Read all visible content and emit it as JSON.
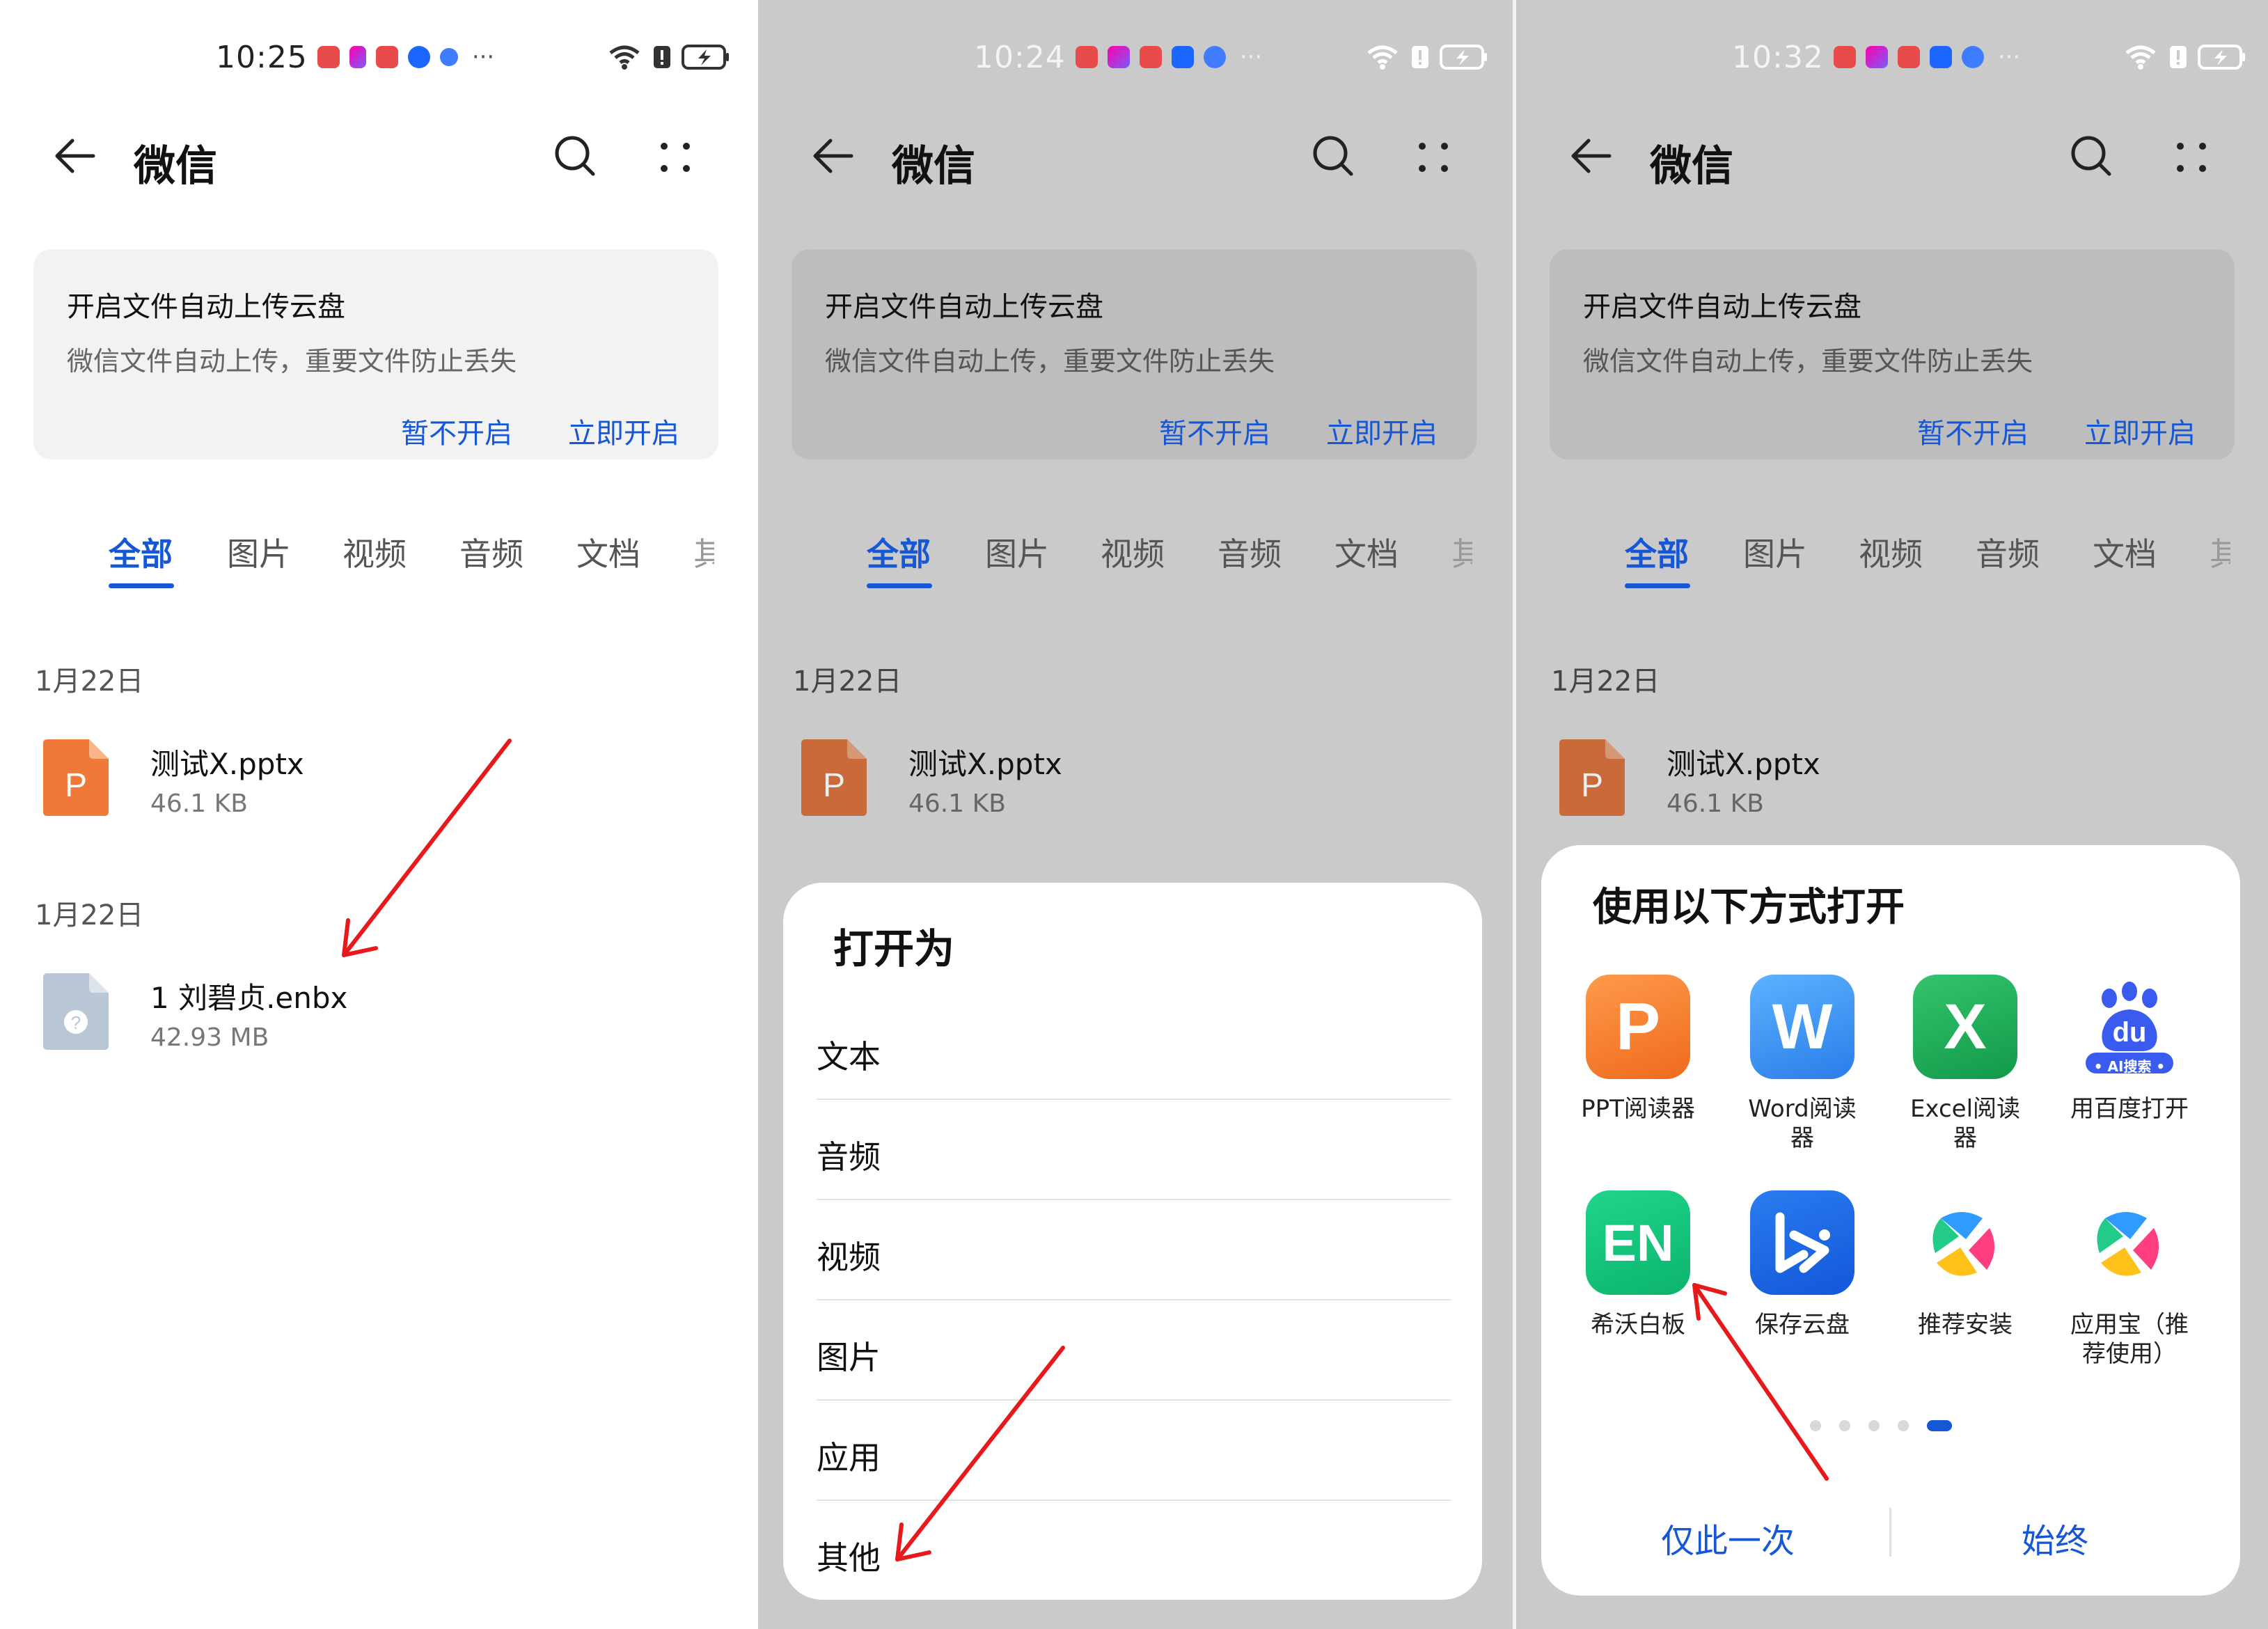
{
  "screens": [
    {
      "time": "10:25",
      "title": "微信",
      "banner": {
        "title": "开启文件自动上传云盘",
        "subtitle": "微信文件自动上传，重要文件防止丢失",
        "btn_later": "暂不开启",
        "btn_now": "立即开启"
      },
      "tabs": [
        "全部",
        "图片",
        "视频",
        "音频",
        "文档",
        "其"
      ],
      "groups": [
        {
          "date": "1月22日",
          "file": {
            "name": "测试X.pptx",
            "size": "46.1 KB",
            "icon": "ppt-file-icon"
          }
        },
        {
          "date": "1月22日",
          "file": {
            "name": "1 刘碧贞.enbx",
            "size": "42.93 MB",
            "icon": "unknown-file-icon"
          }
        }
      ]
    },
    {
      "time": "10:24",
      "title": "微信",
      "banner": {
        "title": "开启文件自动上传云盘",
        "subtitle": "微信文件自动上传，重要文件防止丢失",
        "btn_later": "暂不开启",
        "btn_now": "立即开启"
      },
      "tabs": [
        "全部",
        "图片",
        "视频",
        "音频",
        "文档",
        "其"
      ],
      "groups": [
        {
          "date": "1月22日",
          "file": {
            "name": "测试X.pptx",
            "size": "46.1 KB",
            "icon": "ppt-file-icon"
          }
        }
      ],
      "sheet": {
        "title": "打开为",
        "options": [
          "文本",
          "音频",
          "视频",
          "图片",
          "应用",
          "其他"
        ]
      }
    },
    {
      "time": "10:32",
      "title": "微信",
      "banner": {
        "title": "开启文件自动上传云盘",
        "subtitle": "微信文件自动上传，重要文件防止丢失",
        "btn_later": "暂不开启",
        "btn_now": "立即开启"
      },
      "tabs": [
        "全部",
        "图片",
        "视频",
        "音频",
        "文档",
        "其"
      ],
      "groups": [
        {
          "date": "1月22日",
          "file": {
            "name": "测试X.pptx",
            "size": "46.1 KB",
            "icon": "ppt-file-icon"
          }
        }
      ],
      "sheet": {
        "title": "使用以下方式打开",
        "apps": [
          {
            "label": "PPT阅读器",
            "glyph": "P"
          },
          {
            "label": "Word阅读器",
            "glyph": "W"
          },
          {
            "label": "Excel阅读器",
            "glyph": "X"
          },
          {
            "label": "用百度打开",
            "glyph": "du",
            "badge": "• AI搜索 •"
          },
          {
            "label": "希沃白板",
            "glyph": "EN"
          },
          {
            "label": "保存云盘",
            "glyph": ""
          },
          {
            "label": "推荐安装",
            "glyph": ""
          },
          {
            "label": "应用宝（推荐使用）",
            "glyph": ""
          }
        ],
        "page_count": 5,
        "page_active": 5,
        "btn_once": "仅此一次",
        "btn_always": "始终"
      }
    }
  ],
  "colors": {
    "accent": "#1657d6",
    "annotation_arrow": "#e8191b",
    "ppt_orange": "#f0793a"
  }
}
